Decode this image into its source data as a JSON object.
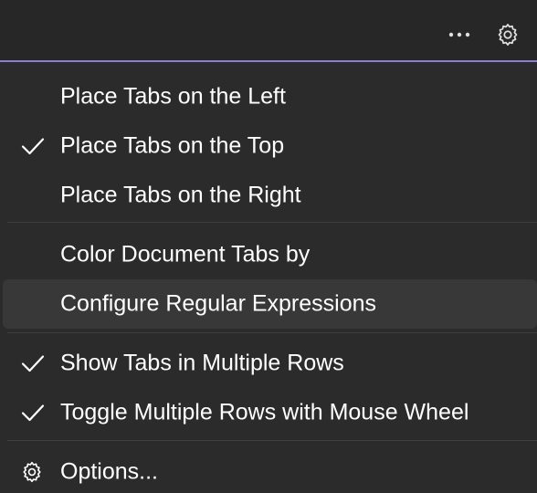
{
  "toolbar": {
    "more_icon": "more-horizontal-icon",
    "settings_icon": "gear-icon"
  },
  "menu": {
    "items": [
      {
        "label": "Place Tabs on the Left",
        "checked": false
      },
      {
        "label": "Place Tabs on the Top",
        "checked": true
      },
      {
        "label": "Place Tabs on the Right",
        "checked": false
      },
      {
        "label": "Color Document Tabs by",
        "checked": false
      },
      {
        "label": "Configure Regular Expressions",
        "checked": false,
        "highlighted": true
      },
      {
        "label": "Show Tabs in Multiple Rows",
        "checked": true
      },
      {
        "label": "Toggle Multiple Rows with Mouse Wheel",
        "checked": true
      },
      {
        "label": "Options...",
        "icon": "gear-icon"
      }
    ]
  },
  "colors": {
    "accent_line": "#8a7fd4",
    "menu_background": "#2b2b2b",
    "highlight_background": "#383838",
    "text": "#ffffff"
  }
}
